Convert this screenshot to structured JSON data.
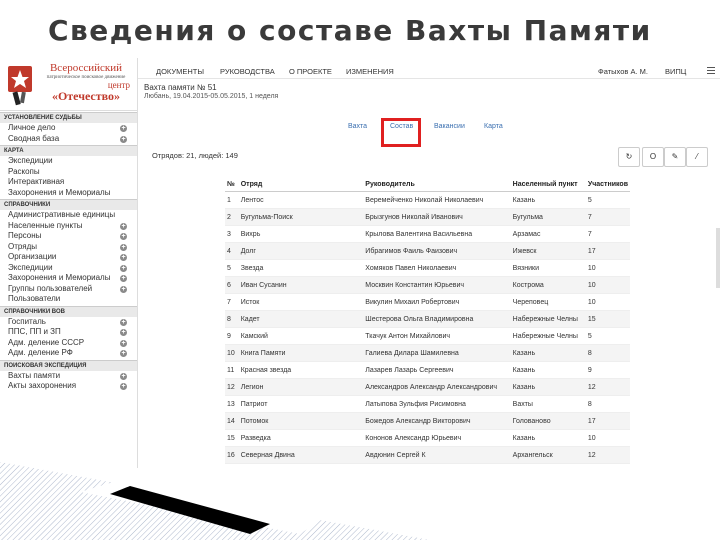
{
  "slide": {
    "title": "Сведения о составе Вахты Памяти"
  },
  "logo": {
    "line1": "Всероссийский",
    "line2": "патриотическое поисковое движение",
    "line3": "центр",
    "line4": "«Отечество»"
  },
  "sidebar": {
    "sections": [
      {
        "title": "УСТАНОВЛЕНИЕ СУДЬБЫ",
        "items": [
          {
            "label": "Личное дело",
            "plus": true
          },
          {
            "label": "Сводная база",
            "plus": true
          }
        ]
      },
      {
        "title": "КАРТА",
        "items": [
          {
            "label": "Экспедиции",
            "plus": false
          },
          {
            "label": "Раскопы",
            "plus": false
          },
          {
            "label": "Интерактивная",
            "plus": false
          },
          {
            "label": "Захоронения и Мемориалы",
            "plus": false
          }
        ]
      },
      {
        "title": "СПРАВОЧНИКИ",
        "items": [
          {
            "label": "Административные единицы",
            "plus": false
          },
          {
            "label": "Населенные пункты",
            "plus": true
          },
          {
            "label": "Персоны",
            "plus": true
          },
          {
            "label": "Отряды",
            "plus": true
          },
          {
            "label": "Организации",
            "plus": true
          },
          {
            "label": "Экспедиции",
            "plus": true
          },
          {
            "label": "Захоронения и Мемориалы",
            "plus": true
          },
          {
            "label": "Группы пользователей",
            "plus": true
          },
          {
            "label": "Пользователи",
            "plus": false
          }
        ]
      },
      {
        "title": "СПРАВОЧНИКИ ВОВ",
        "items": [
          {
            "label": "Госпиталь",
            "plus": true
          },
          {
            "label": "ППС, ПП и ЗП",
            "plus": true
          },
          {
            "label": "Адм. деление СССР",
            "plus": true
          },
          {
            "label": "Адм. деление РФ",
            "plus": true
          }
        ]
      },
      {
        "title": "ПОИСКОВАЯ ЭКСПЕДИЦИЯ",
        "items": [
          {
            "label": "Вахты памяти",
            "plus": true
          },
          {
            "label": "Акты захоронения",
            "plus": true
          }
        ]
      }
    ]
  },
  "topnav": {
    "items": [
      "ДОКУМЕНТЫ",
      "РУКОВОДСТВА",
      "О ПРОЕКТЕ",
      "ИЗМЕНЕНИЯ"
    ],
    "user": "Фатыхов А. М.",
    "org": "ВИПЦ"
  },
  "watch": {
    "title": "Вахта памяти № 51",
    "subtitle": "Любань, 19.04.2015-05.05.2015, 1 неделя"
  },
  "tabs": [
    "Вахта",
    "Состав",
    "Вакансии",
    "Карта"
  ],
  "found_text": "Отрядов: 21, людей: 149",
  "table": {
    "headers": [
      "№",
      "Отряд",
      "Руководитель",
      "Населенный пункт",
      "Участников"
    ],
    "rows": [
      [
        "1",
        "Лентос",
        "Веремейченко Николай Николаевич",
        "Казань",
        "5"
      ],
      [
        "2",
        "Бугульма-Поиск",
        "Брызгунов Николай Иванович",
        "Бугульма",
        "7"
      ],
      [
        "3",
        "Вихрь",
        "Крылова Валентина Васильевна",
        "Арзамас",
        "7"
      ],
      [
        "4",
        "Долг",
        "Ибрагимов Фаиль Фаизович",
        "Ижевск",
        "17"
      ],
      [
        "5",
        "Звезда",
        "Хомяков Павел Николаевич",
        "Вязники",
        "10"
      ],
      [
        "6",
        "Иван Сусанин",
        "Москвин Константин Юрьевич",
        "Кострома",
        "10"
      ],
      [
        "7",
        "Исток",
        "Викулин Михаил Робертович",
        "Череповец",
        "10"
      ],
      [
        "8",
        "Кадет",
        "Шестерова Ольга Владимировна",
        "Набережные Челны",
        "15"
      ],
      [
        "9",
        "Камский",
        "Ткачук Антон Михайлович",
        "Набережные Челны",
        "5"
      ],
      [
        "10",
        "Книга Памяти",
        "Галиева Дилара Шамилевна",
        "Казань",
        "8"
      ],
      [
        "11",
        "Красная звезда",
        "Лазарев Лазарь Сергеевич",
        "Казань",
        "9"
      ],
      [
        "12",
        "Легион",
        "Александров Александр Александрович",
        "Казань",
        "12"
      ],
      [
        "13",
        "Патриот",
        "Латыпова Зульфия Рисимовна",
        "Вахты",
        "8"
      ],
      [
        "14",
        "Потомок",
        "Божедов Александр Викторович",
        "Голованово",
        "17"
      ],
      [
        "15",
        "Разведка",
        "Кононов Александр Юрьевич",
        "Казань",
        "10"
      ],
      [
        "16",
        "Северная Двина",
        "Авдюнин Сергей К",
        "Архангельск",
        "12"
      ]
    ]
  },
  "colors": {
    "link": "#3a6fb0",
    "highlight": "#e02020",
    "brand": "#c0392b"
  }
}
